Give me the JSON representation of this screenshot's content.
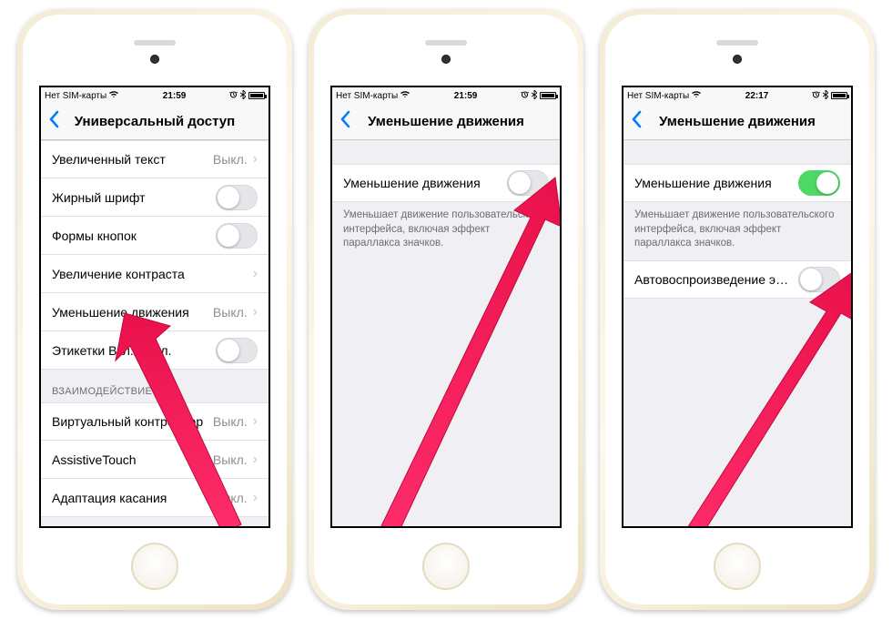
{
  "phones": [
    {
      "status": {
        "carrier": "Нет SIM-карты",
        "time": "21:59"
      },
      "nav_title": "Универсальный доступ",
      "section_header": "ВЗАИМОДЕЙСТВИЕ",
      "off_value": "Выкл.",
      "items": {
        "larger_text": "Увеличенный текст",
        "bold_text": "Жирный шрифт",
        "button_shapes": "Формы кнопок",
        "increase_contrast": "Увеличение контраста",
        "reduce_motion": "Уменьшение движения",
        "on_off_labels": "Этикетки Вкл./Выкл.",
        "switch_control": "Виртуальный контроллер",
        "assistive_touch": "AssistiveTouch",
        "touch_accom": "Адаптация касания"
      }
    },
    {
      "status": {
        "carrier": "Нет SIM-карты",
        "time": "21:59"
      },
      "nav_title": "Уменьшение движения",
      "items": {
        "reduce_motion": "Уменьшение движения"
      },
      "footer": "Уменьшает движение пользовательского интерфейса, включая эффект параллакса значков."
    },
    {
      "status": {
        "carrier": "Нет SIM-карты",
        "time": "22:17"
      },
      "nav_title": "Уменьшение движения",
      "items": {
        "reduce_motion": "Уменьшение движения",
        "auto_play": "Автовоспроизведение эфф…"
      },
      "footer": "Уменьшает движение пользовательского интерфейса, включая эффект параллакса значков."
    }
  ]
}
